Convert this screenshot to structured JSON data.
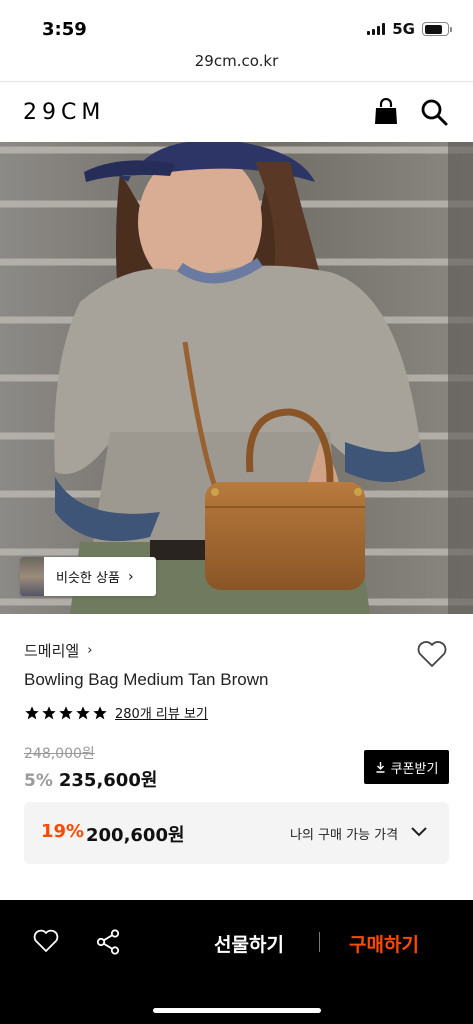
{
  "status_bar": {
    "time": "3:59",
    "network": "5G"
  },
  "browser": {
    "url": "29cm.co.kr"
  },
  "header": {
    "logo": "29CM",
    "icons": [
      "shopping-bag-icon",
      "search-icon"
    ]
  },
  "hero": {
    "similar_button_label": "비슷한 상품"
  },
  "product": {
    "brand": "드메리엘",
    "name": "Bowling Bag Medium Tan Brown",
    "rating_stars": 5,
    "review_link": "280개 리뷰 보기",
    "original_price": "248,000원",
    "discount": "5%",
    "sale_price": "235,600원",
    "coupon_label": "쿠폰받기"
  },
  "best_price": {
    "discount": "19%",
    "price": "200,600원",
    "label": "나의 구매 가능 가격"
  },
  "bottom_bar": {
    "gift_label": "선물하기",
    "buy_label": "구매하기"
  },
  "colors": {
    "accent": "#ff4800",
    "bottom_bar_bg": "#000000"
  }
}
